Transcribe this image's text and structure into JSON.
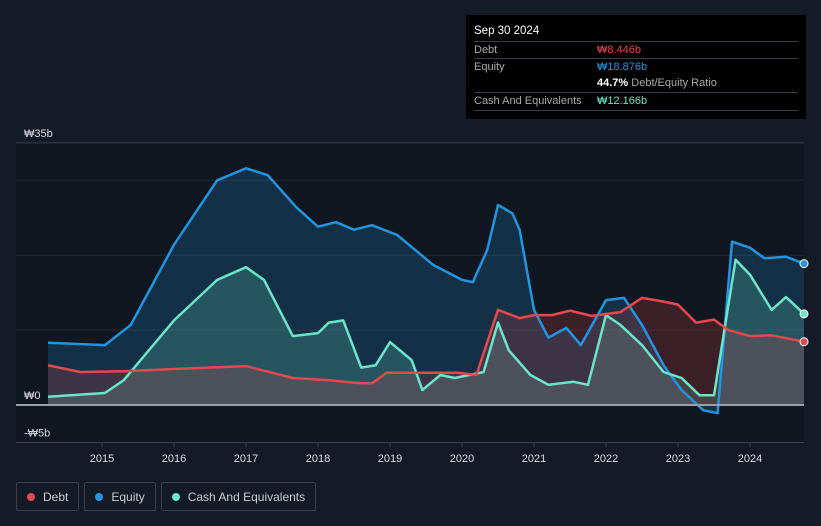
{
  "tooltip": {
    "date": "Sep 30 2024",
    "debt_label": "Debt",
    "debt_value": "₩8.446b",
    "equity_label": "Equity",
    "equity_value": "₩18.876b",
    "ratio_value": "44.7%",
    "ratio_label": "Debt/Equity Ratio",
    "cash_label": "Cash And Equivalents",
    "cash_value": "₩12.166b"
  },
  "legend": [
    {
      "label": "Debt",
      "color": "#e5484d"
    },
    {
      "label": "Equity",
      "color": "#2394df"
    },
    {
      "label": "Cash And Equivalents",
      "color": "#6ce5c8"
    }
  ],
  "chart_data": {
    "type": "area",
    "ylim": [
      -5,
      35
    ],
    "yticks": [
      {
        "v": 35,
        "label": "₩35b"
      },
      {
        "v": 0,
        "label": "₩0"
      },
      {
        "v": -5,
        "label": "-₩5b"
      }
    ],
    "xlim": [
      2014.25,
      2024.75
    ],
    "xticks": [
      "2015",
      "2016",
      "2017",
      "2018",
      "2019",
      "2020",
      "2021",
      "2022",
      "2023",
      "2024"
    ],
    "grid": true,
    "legend_position": "bottom-left",
    "series": [
      {
        "name": "Equity",
        "color": "#2394df",
        "points": [
          [
            2014.25,
            8.3
          ],
          [
            2015.04,
            8.0
          ],
          [
            2015.4,
            10.7
          ],
          [
            2016,
            21.4
          ],
          [
            2016.6,
            30
          ],
          [
            2017,
            31.6
          ],
          [
            2017.3,
            30.7
          ],
          [
            2017.7,
            26.4
          ],
          [
            2018,
            23.8
          ],
          [
            2018.25,
            24.4
          ],
          [
            2018.5,
            23.4
          ],
          [
            2018.75,
            24
          ],
          [
            2019.1,
            22.7
          ],
          [
            2019.6,
            18.7
          ],
          [
            2020,
            16.7
          ],
          [
            2020.15,
            16.4
          ],
          [
            2020.35,
            20.7
          ],
          [
            2020.5,
            26.7
          ],
          [
            2020.7,
            25.6
          ],
          [
            2020.8,
            23.4
          ],
          [
            2021,
            12.7
          ],
          [
            2021.2,
            9
          ],
          [
            2021.45,
            10.3
          ],
          [
            2021.65,
            8
          ],
          [
            2022,
            14
          ],
          [
            2022.25,
            14.3
          ],
          [
            2022.5,
            10.7
          ],
          [
            2022.8,
            5.3
          ],
          [
            2023.05,
            2
          ],
          [
            2023.35,
            -0.7
          ],
          [
            2023.55,
            -1.1
          ],
          [
            2023.75,
            21.8
          ],
          [
            2024,
            21
          ],
          [
            2024.2,
            19.6
          ],
          [
            2024.5,
            19.8
          ],
          [
            2024.75,
            18.876
          ]
        ]
      },
      {
        "name": "Cash And Equivalents",
        "color": "#6ce5c8",
        "points": [
          [
            2014.25,
            1.1
          ],
          [
            2015.04,
            1.6
          ],
          [
            2015.3,
            3.3
          ],
          [
            2016,
            11.3
          ],
          [
            2016.6,
            16.7
          ],
          [
            2017,
            18.4
          ],
          [
            2017.25,
            16.7
          ],
          [
            2017.65,
            9.2
          ],
          [
            2018,
            9.6
          ],
          [
            2018.15,
            11
          ],
          [
            2018.35,
            11.3
          ],
          [
            2018.6,
            5
          ],
          [
            2018.8,
            5.3
          ],
          [
            2019,
            8.4
          ],
          [
            2019.3,
            6
          ],
          [
            2019.45,
            2
          ],
          [
            2019.7,
            4
          ],
          [
            2019.9,
            3.6
          ],
          [
            2020.3,
            4.4
          ],
          [
            2020.5,
            11
          ],
          [
            2020.65,
            7.3
          ],
          [
            2020.95,
            4
          ],
          [
            2021.2,
            2.7
          ],
          [
            2021.55,
            3.1
          ],
          [
            2021.75,
            2.7
          ],
          [
            2022,
            12
          ],
          [
            2022.2,
            10.7
          ],
          [
            2022.5,
            8
          ],
          [
            2022.8,
            4.4
          ],
          [
            2023.05,
            3.6
          ],
          [
            2023.3,
            1.3
          ],
          [
            2023.5,
            1.3
          ],
          [
            2023.8,
            19.4
          ],
          [
            2024,
            17.4
          ],
          [
            2024.3,
            12.7
          ],
          [
            2024.5,
            14.4
          ],
          [
            2024.75,
            12.166
          ]
        ]
      },
      {
        "name": "Debt",
        "color": "#e5484d",
        "points": [
          [
            2014.25,
            5.3
          ],
          [
            2014.7,
            4.4
          ],
          [
            2015.3,
            4.5
          ],
          [
            2016,
            4.8
          ],
          [
            2017,
            5.2
          ],
          [
            2017.65,
            3.6
          ],
          [
            2018.15,
            3.3
          ],
          [
            2018.6,
            2.9
          ],
          [
            2018.75,
            2.9
          ],
          [
            2018.95,
            4.3
          ],
          [
            2019.45,
            4.3
          ],
          [
            2019.95,
            4.3
          ],
          [
            2020.2,
            4
          ],
          [
            2020.5,
            12.7
          ],
          [
            2020.8,
            11.6
          ],
          [
            2021,
            12
          ],
          [
            2021.25,
            12
          ],
          [
            2021.5,
            12.6
          ],
          [
            2021.8,
            11.9
          ],
          [
            2022.2,
            12.4
          ],
          [
            2022.5,
            14.3
          ],
          [
            2022.8,
            13.8
          ],
          [
            2023,
            13.4
          ],
          [
            2023.25,
            11
          ],
          [
            2023.5,
            11.4
          ],
          [
            2023.7,
            10
          ],
          [
            2024,
            9.2
          ],
          [
            2024.3,
            9.3
          ],
          [
            2024.75,
            8.446
          ]
        ]
      }
    ]
  }
}
